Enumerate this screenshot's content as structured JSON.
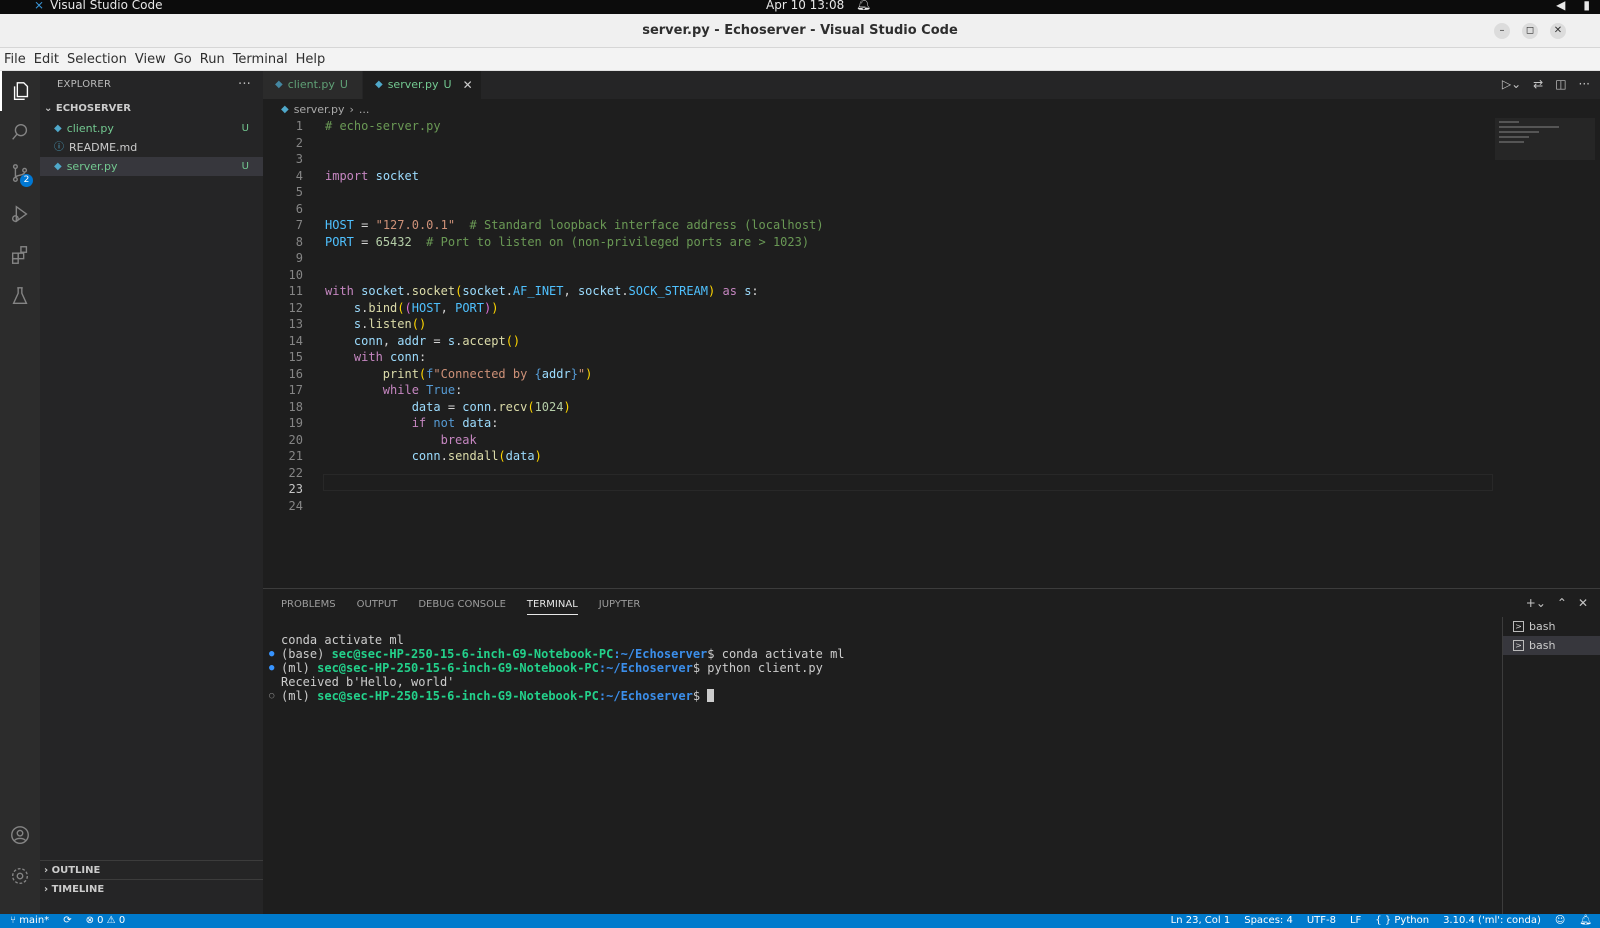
{
  "os_bar": {
    "app_name": "Visual Studio Code",
    "clock": "Apr 10  13:08"
  },
  "window": {
    "title": "server.py - Echoserver - Visual Studio Code"
  },
  "menu": [
    "File",
    "Edit",
    "Selection",
    "View",
    "Go",
    "Run",
    "Terminal",
    "Help"
  ],
  "activity_bar": {
    "source_control_badge": "2"
  },
  "explorer": {
    "header": "EXPLORER",
    "more": "···",
    "folder": "ECHOSERVER",
    "files": [
      {
        "name": "client.py",
        "status": "U"
      },
      {
        "name": "README.md",
        "status": ""
      },
      {
        "name": "server.py",
        "status": "U"
      }
    ],
    "outline": "OUTLINE",
    "timeline": "TIMELINE"
  },
  "tabs": [
    {
      "name": "client.py",
      "status": "U"
    },
    {
      "name": "server.py",
      "status": "U"
    }
  ],
  "breadcrumb": {
    "file": "server.py",
    "rest": "..."
  },
  "editor": {
    "current_line": 23,
    "line_numbers": [
      "1",
      "2",
      "3",
      "4",
      "5",
      "6",
      "7",
      "8",
      "9",
      "10",
      "11",
      "12",
      "13",
      "14",
      "15",
      "16",
      "17",
      "18",
      "19",
      "20",
      "21",
      "22",
      "23",
      "24"
    ]
  },
  "panel": {
    "tabs": [
      "PROBLEMS",
      "OUTPUT",
      "DEBUG CONSOLE",
      "TERMINAL",
      "JUPYTER"
    ],
    "active_tab": "TERMINAL",
    "terminal": {
      "line1": "conda activate ml",
      "l2_env": "(base) ",
      "l2_user": "sec@sec-HP-250-15-6-inch-G9-Notebook-PC",
      "l2_path": ":~/Echoserver",
      "l2_cmd": "$ conda activate ml",
      "l3_env": "(ml) ",
      "l3_user": "sec@sec-HP-250-15-6-inch-G9-Notebook-PC",
      "l3_path": ":~/Echoserver",
      "l3_cmd": "$ python client.py",
      "line4": "Received b'Hello, world'",
      "l5_env": "(ml) ",
      "l5_user": "sec@sec-HP-250-15-6-inch-G9-Notebook-PC",
      "l5_path": ":~/Echoserver",
      "l5_cmd": "$ "
    },
    "terminals": [
      "bash",
      "bash"
    ]
  },
  "status": {
    "branch": "main*",
    "problems": "⊗ 0 ⚠ 0",
    "cursor": "Ln 23, Col 1",
    "spaces": "Spaces: 4",
    "encoding": "UTF-8",
    "eol": "LF",
    "language": "Python",
    "interpreter": "3.10.4 ('ml': conda)"
  }
}
